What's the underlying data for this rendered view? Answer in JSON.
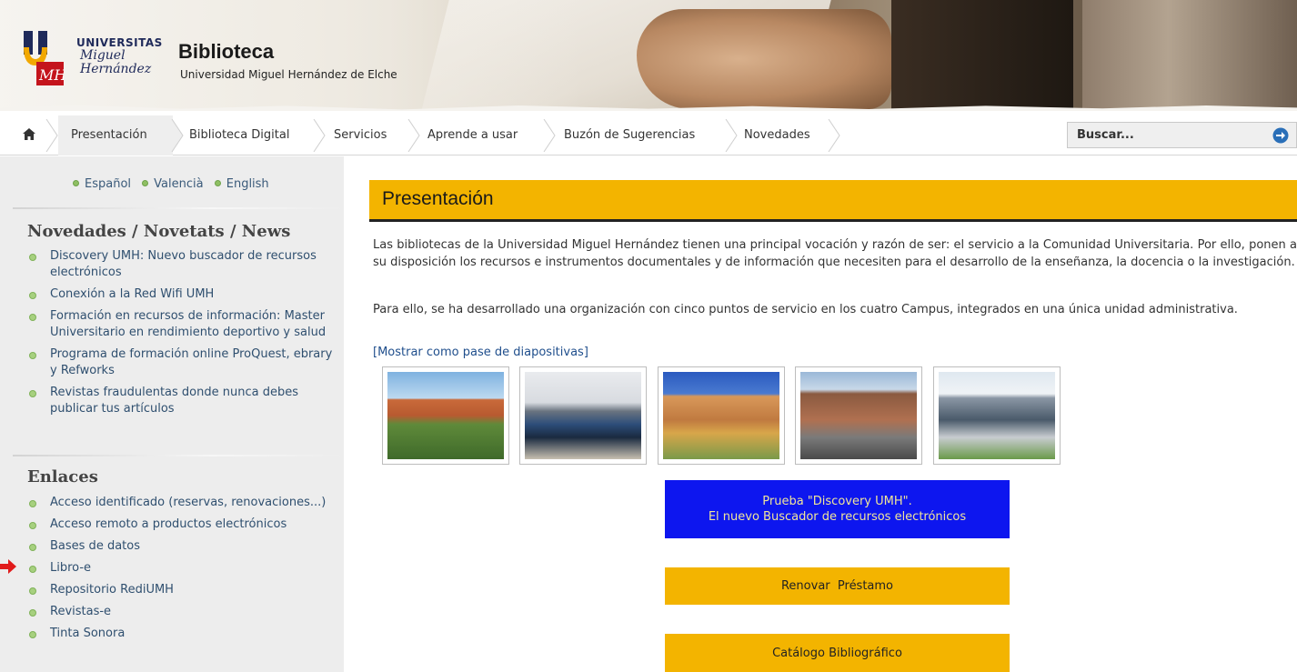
{
  "header": {
    "logo": {
      "line1": "UNIVERSITAS",
      "line2": "Miguel",
      "line3": "Hernández"
    },
    "title": "Biblioteca",
    "subtitle": "Universidad Miguel Hernández de Elche"
  },
  "nav": {
    "home_icon": "home-icon",
    "items": [
      {
        "label": "Presentación",
        "active": true
      },
      {
        "label": "Biblioteca Digital"
      },
      {
        "label": "Servicios"
      },
      {
        "label": "Aprende a usar"
      },
      {
        "label": "Buzón de Sugerencias"
      },
      {
        "label": "Novedades"
      }
    ],
    "search": {
      "placeholder": "Buscar...",
      "icon": "arrow-right-circle-icon"
    }
  },
  "sidebar": {
    "languages": [
      "Español",
      "Valencià",
      "English"
    ],
    "news_title": "Novedades / Novetats / News",
    "news": [
      "Discovery UMH: Nuevo buscador de recursos electrónicos",
      "Conexión a la Red Wifi UMH",
      "Formación en recursos de información: Master Universitario en rendimiento deportivo y salud",
      "Programa de formación online ProQuest, ebrary y Refworks",
      "Revistas fraudulentas donde nunca debes publicar tus artículos"
    ],
    "links_title": "Enlaces",
    "links": [
      "Acceso identificado (reservas, renovaciones...)",
      "Acceso remoto a productos electrónicos",
      "Bases de datos",
      "Libro-e",
      "Repositorio RediUMH",
      "Revistas-e",
      "Tinta Sonora"
    ]
  },
  "main": {
    "title": "Presentación",
    "paragraph1": "Las bibliotecas de la Universidad Miguel Hernández tienen una principal vocación y razón de ser: el servicio a la Comunidad Universitaria. Por ello, ponen a su disposición los recursos e instrumentos documentales y de información que necesiten para el desarrollo de la enseñanza, la docencia o la investigación.",
    "paragraph2": "Para ello, se ha desarrollado una organización con cinco puntos de servicio en los cuatro Campus, integrados en una única unidad administrativa.",
    "slideshow_link": "[Mostrar como pase de diapositivas]",
    "buttons": {
      "discovery_line1": "Prueba \"Discovery UMH\".",
      "discovery_line2": "El nuevo Buscador de recursos electrónicos",
      "renovar": "Renovar  Préstamo",
      "catalogo": "Catálogo Bibliográfico"
    }
  },
  "colors": {
    "accent_yellow": "#f3b400",
    "discovery_blue": "#0d16ef",
    "sidebar_bg": "#ededed",
    "bullet_green": "#a7d07f",
    "pointer_red": "#e11b1b"
  }
}
